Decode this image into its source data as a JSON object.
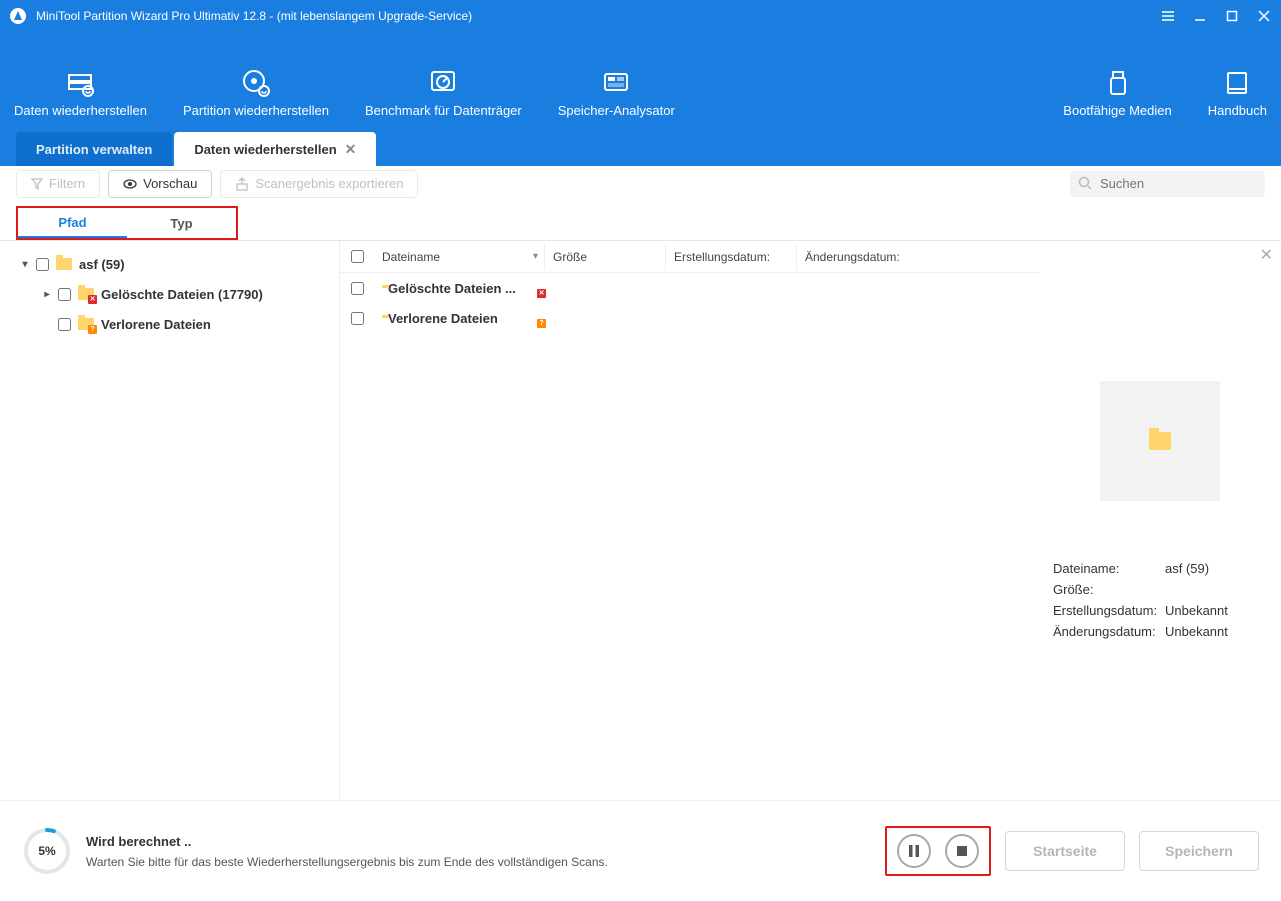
{
  "titlebar": {
    "title": "MiniTool Partition Wizard Pro Ultimativ 12.8 - (mit lebenslangem Upgrade-Service)"
  },
  "toolbar": {
    "items": [
      {
        "label": "Daten wiederherstellen"
      },
      {
        "label": "Partition wiederherstellen"
      },
      {
        "label": "Benchmark für Datenträger"
      },
      {
        "label": "Speicher-Analysator"
      }
    ],
    "right": [
      {
        "label": "Bootfähige Medien"
      },
      {
        "label": "Handbuch"
      }
    ]
  },
  "tabs": {
    "inactive": "Partition verwalten",
    "active": "Daten wiederherstellen"
  },
  "actions": {
    "filter": "Filtern",
    "preview": "Vorschau",
    "export": "Scanergebnis exportieren",
    "search_placeholder": "Suchen"
  },
  "subtabs": {
    "path": "Pfad",
    "type": "Typ"
  },
  "tree": {
    "root": "asf (59)",
    "deleted": "Gelöschte Dateien (17790)",
    "lost": "Verlorene Dateien"
  },
  "list": {
    "headers": {
      "name": "Dateiname",
      "size": "Größe",
      "cdate": "Erstellungsdatum:",
      "mdate": "Änderungsdatum:"
    },
    "rows": [
      {
        "name": "Gelöschte Dateien ...",
        "badge": "x"
      },
      {
        "name": "Verlorene Dateien",
        "badge": "q"
      }
    ]
  },
  "preview": {
    "filename_label": "Dateiname:",
    "filename": "asf (59)",
    "size_label": "Größe:",
    "size": "",
    "cdate_label": "Erstellungsdatum:",
    "cdate": "Unbekannt",
    "mdate_label": "Änderungsdatum:",
    "mdate": "Unbekannt"
  },
  "footer": {
    "percent": "5%",
    "line1": "Wird berechnet ..",
    "line2": "Warten Sie bitte für das beste Wiederherstellungsergebnis bis zum Ende des vollständigen Scans.",
    "home": "Startseite",
    "save": "Speichern"
  }
}
